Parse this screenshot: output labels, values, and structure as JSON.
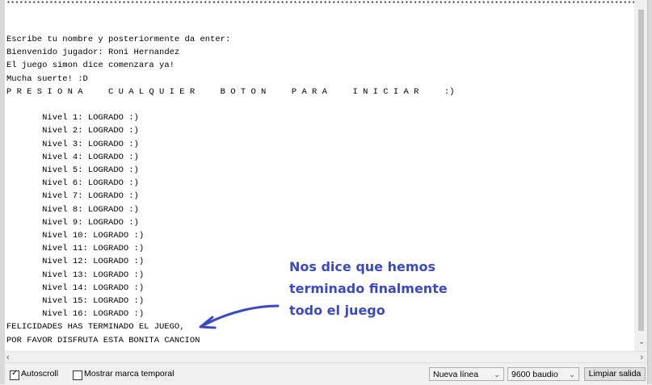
{
  "console": {
    "separator": "*******************************************************************************************************************************************************",
    "lines": [
      "Escribe tu nombre y posteriormente da enter:",
      "Bienvenido jugador: Roni Hernandez",
      "El juego simon dice comenzara ya!",
      "Mucha suerte! :D",
      "P R E S I O N A     C U A L Q U I E R     B O T O N     P A R A     I N I C I A R     :)",
      "",
      "       Nivel 1: LOGRADO :)",
      "       Nivel 2: LOGRADO :)",
      "       Nivel 3: LOGRADO :)",
      "       Nivel 4: LOGRADO :)",
      "       Nivel 5: LOGRADO :)",
      "       Nivel 6: LOGRADO :)",
      "       Nivel 7: LOGRADO :)",
      "       Nivel 8: LOGRADO :)",
      "       Nivel 9: LOGRADO :)",
      "       Nivel 10: LOGRADO :)",
      "       Nivel 11: LOGRADO :)",
      "       Nivel 12: LOGRADO :)",
      "       Nivel 13: LOGRADO :)",
      "       Nivel 14: LOGRADO :)",
      "       Nivel 15: LOGRADO :)",
      "       Nivel 16: LOGRADO :)",
      "FELICIDADES HAS TERMINADO EL JUEGO,",
      "POR FAVOR DISFRUTA ESTA BONITA CANCION"
    ]
  },
  "annotation": {
    "lines": [
      "Nos dice que hemos",
      "terminado finalmente",
      "todo el juego"
    ],
    "color": "#3a49c4"
  },
  "toolbar": {
    "autoscroll_label": "Autoscroll",
    "autoscroll_checked": true,
    "timestamp_label": "Mostrar marca temporal",
    "timestamp_checked": false,
    "line_ending": "Nueva línea",
    "baud_rate": "9600 baudio",
    "clear_label": "Limpiar salida"
  }
}
